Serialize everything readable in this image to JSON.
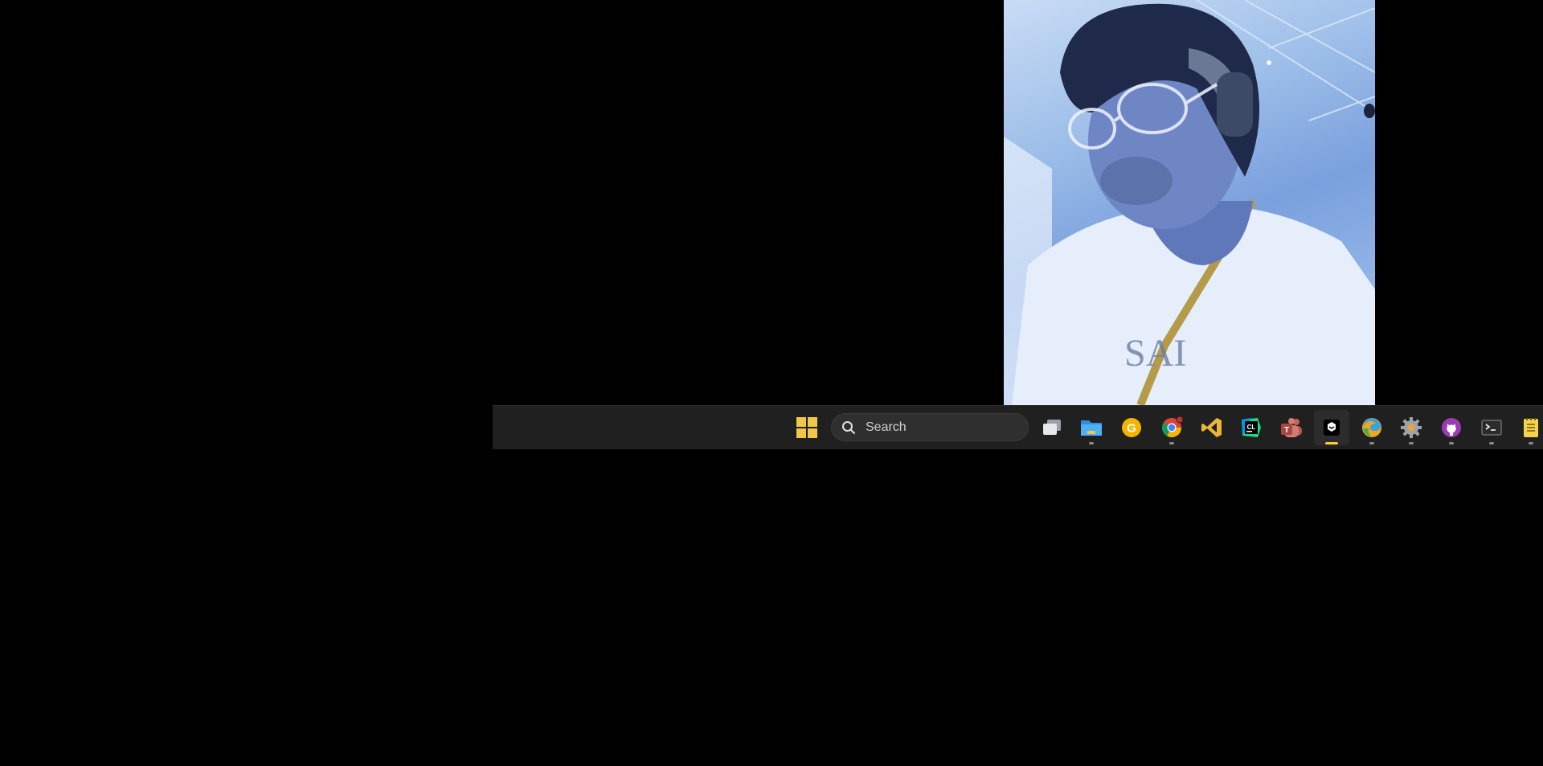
{
  "webcam": {
    "label": "webcam-preview"
  },
  "taskbar": {
    "search": {
      "placeholder": "Search"
    },
    "apps": [
      {
        "name": "task-view",
        "active": false,
        "open": false
      },
      {
        "name": "file-explorer",
        "active": false,
        "open": true
      },
      {
        "name": "google",
        "active": false,
        "open": false
      },
      {
        "name": "chrome",
        "active": false,
        "open": true
      },
      {
        "name": "visual-studio",
        "active": false,
        "open": false
      },
      {
        "name": "clion",
        "active": false,
        "open": false
      },
      {
        "name": "teams",
        "active": false,
        "open": false
      },
      {
        "name": "app-active",
        "active": true,
        "open": true
      },
      {
        "name": "edge",
        "active": false,
        "open": true
      },
      {
        "name": "settings",
        "active": false,
        "open": true
      },
      {
        "name": "github-desktop",
        "active": false,
        "open": true
      },
      {
        "name": "terminal",
        "active": false,
        "open": true
      },
      {
        "name": "notepad",
        "active": false,
        "open": true
      }
    ]
  },
  "colors": {
    "taskbar_bg": "#202020",
    "accent": "#ffc83d"
  }
}
